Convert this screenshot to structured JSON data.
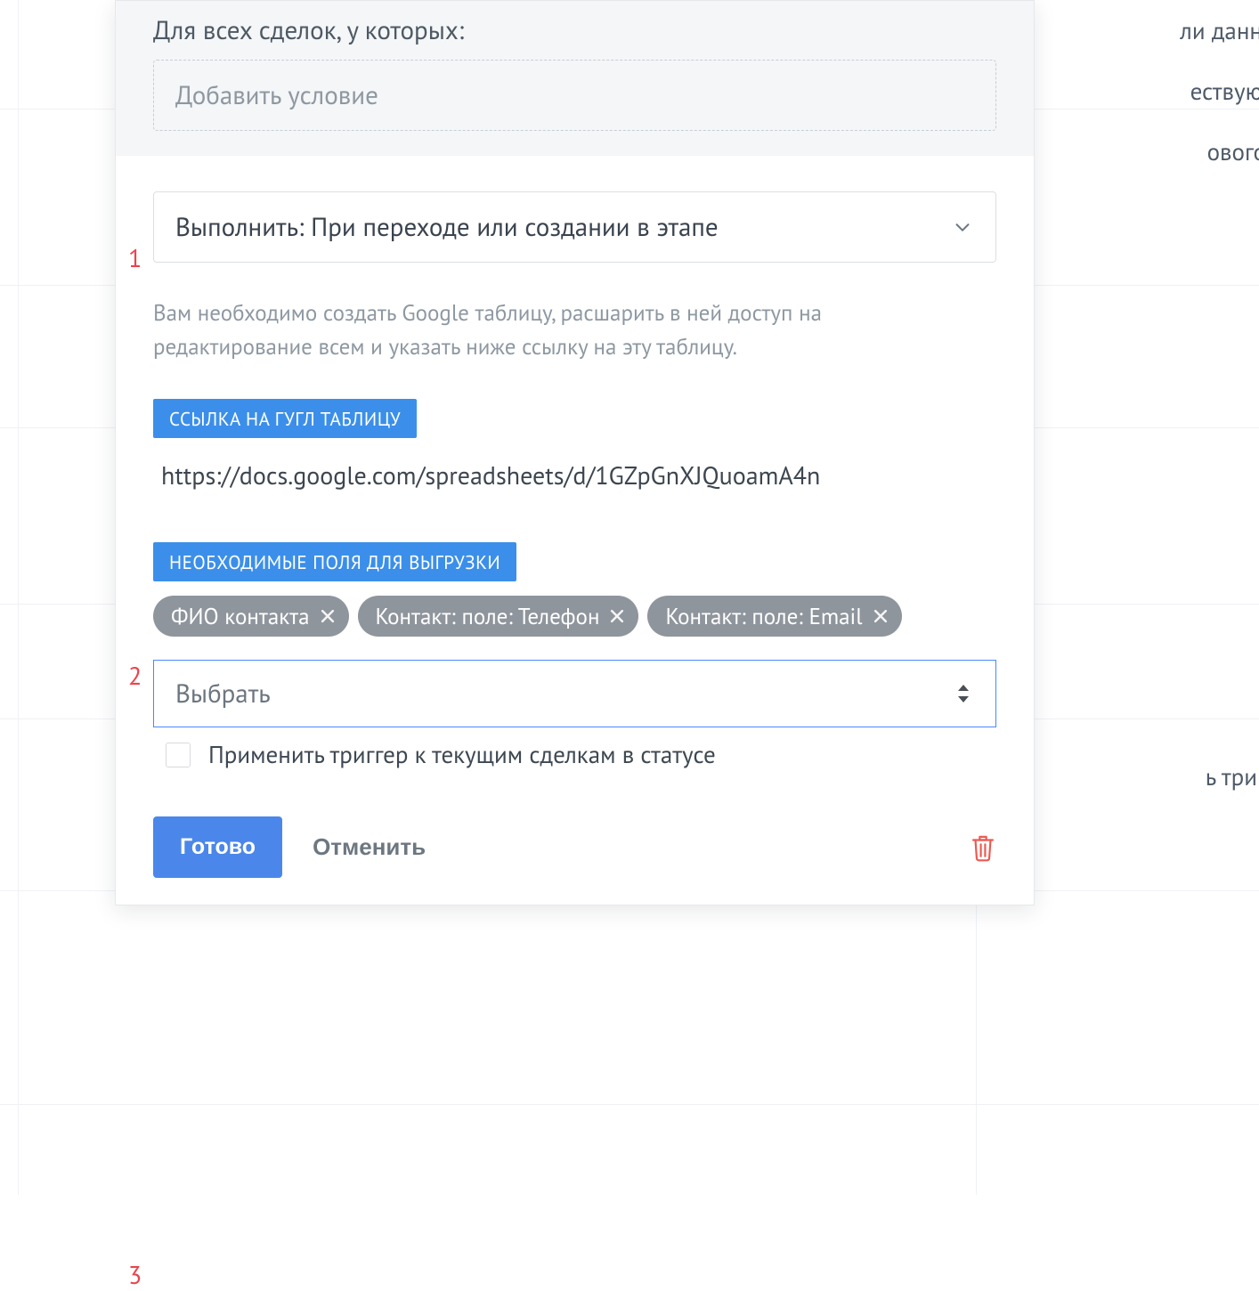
{
  "condition": {
    "title": "Для всех сделок, у которых:",
    "add_placeholder": "Добавить условие"
  },
  "annotations": {
    "n1": "1",
    "n2": "2",
    "n3": "3"
  },
  "trigger": {
    "label": "Выполнить: При переходе или создании в этапе"
  },
  "help_text": "Вам необходимо создать Google таблицу, расшарить в ней доступ на редактирование всем и указать ниже ссылку на эту таблицу.",
  "sheet_link": {
    "label": "ССЫЛКА НА ГУГЛ ТАБЛИЦУ",
    "value": "https://docs.google.com/spreadsheets/d/1GZpGnXJQuoamA4n"
  },
  "export_fields": {
    "label": "НЕОБХОДИМЫЕ ПОЛЯ ДЛЯ ВЫГРУЗКИ",
    "tags": [
      "ФИО контакта",
      "Контакт: поле: Телефон",
      "Контакт: поле: Email"
    ]
  },
  "select": {
    "placeholder": "Выбрать"
  },
  "apply_checkbox": {
    "label": "Применить триггер к текущим сделкам в статусе",
    "checked": false
  },
  "footer": {
    "done": "Готово",
    "cancel": "Отменить"
  },
  "background_fragments": {
    "a": "ли данн",
    "b": "ествую",
    "c": "ового",
    "d": "ь триг"
  }
}
